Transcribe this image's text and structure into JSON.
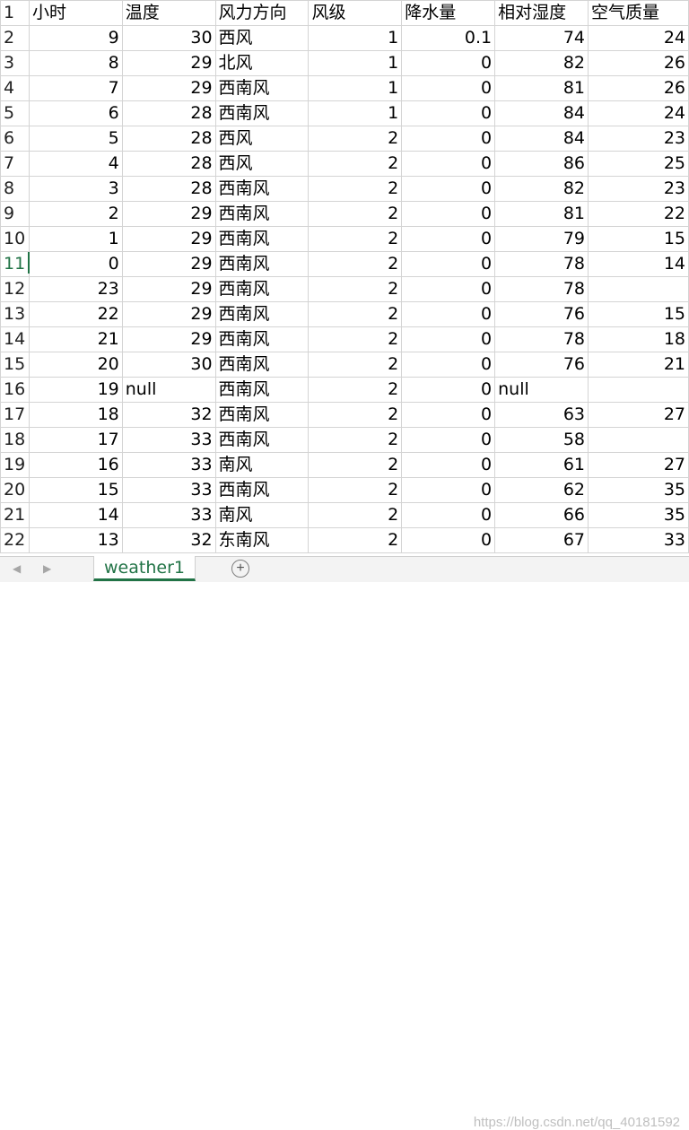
{
  "columns": [
    {
      "label": "小时",
      "align": "num"
    },
    {
      "label": "温度",
      "align": "num"
    },
    {
      "label": "风力方向",
      "align": "txt"
    },
    {
      "label": "风级",
      "align": "num"
    },
    {
      "label": "降水量",
      "align": "num"
    },
    {
      "label": "相对湿度",
      "align": "num"
    },
    {
      "label": "空气质量",
      "align": "num"
    }
  ],
  "header_row_number": "1",
  "selected_row_number": "11",
  "rows": [
    {
      "n": "2",
      "cells": [
        "9",
        "30",
        "西风",
        "1",
        "0.1",
        "74",
        "24"
      ]
    },
    {
      "n": "3",
      "cells": [
        "8",
        "29",
        "北风",
        "1",
        "0",
        "82",
        "26"
      ]
    },
    {
      "n": "4",
      "cells": [
        "7",
        "29",
        "西南风",
        "1",
        "0",
        "81",
        "26"
      ]
    },
    {
      "n": "5",
      "cells": [
        "6",
        "28",
        "西南风",
        "1",
        "0",
        "84",
        "24"
      ]
    },
    {
      "n": "6",
      "cells": [
        "5",
        "28",
        "西风",
        "2",
        "0",
        "84",
        "23"
      ]
    },
    {
      "n": "7",
      "cells": [
        "4",
        "28",
        "西风",
        "2",
        "0",
        "86",
        "25"
      ]
    },
    {
      "n": "8",
      "cells": [
        "3",
        "28",
        "西南风",
        "2",
        "0",
        "82",
        "23"
      ]
    },
    {
      "n": "9",
      "cells": [
        "2",
        "29",
        "西南风",
        "2",
        "0",
        "81",
        "22"
      ]
    },
    {
      "n": "10",
      "cells": [
        "1",
        "29",
        "西南风",
        "2",
        "0",
        "79",
        "15"
      ]
    },
    {
      "n": "11",
      "cells": [
        "0",
        "29",
        "西南风",
        "2",
        "0",
        "78",
        "14"
      ]
    },
    {
      "n": "12",
      "cells": [
        "23",
        "29",
        "西南风",
        "2",
        "0",
        "78",
        ""
      ]
    },
    {
      "n": "13",
      "cells": [
        "22",
        "29",
        "西南风",
        "2",
        "0",
        "76",
        "15"
      ]
    },
    {
      "n": "14",
      "cells": [
        "21",
        "29",
        "西南风",
        "2",
        "0",
        "78",
        "18"
      ]
    },
    {
      "n": "15",
      "cells": [
        "20",
        "30",
        "西南风",
        "2",
        "0",
        "76",
        "21"
      ]
    },
    {
      "n": "16",
      "cells": [
        "19",
        "null",
        "西南风",
        "2",
        "0",
        "null",
        ""
      ]
    },
    {
      "n": "17",
      "cells": [
        "18",
        "32",
        "西南风",
        "2",
        "0",
        "63",
        "27"
      ]
    },
    {
      "n": "18",
      "cells": [
        "17",
        "33",
        "西南风",
        "2",
        "0",
        "58",
        ""
      ]
    },
    {
      "n": "19",
      "cells": [
        "16",
        "33",
        "南风",
        "2",
        "0",
        "61",
        "27"
      ]
    },
    {
      "n": "20",
      "cells": [
        "15",
        "33",
        "西南风",
        "2",
        "0",
        "62",
        "35"
      ]
    },
    {
      "n": "21",
      "cells": [
        "14",
        "33",
        "南风",
        "2",
        "0",
        "66",
        "35"
      ]
    },
    {
      "n": "22",
      "cells": [
        "13",
        "32",
        "东南风",
        "2",
        "0",
        "67",
        "33"
      ]
    }
  ],
  "sheet_tab": {
    "label": "weather1"
  },
  "add_sheet_symbol": "+",
  "nav": {
    "prev": "◀",
    "next": "▶"
  },
  "watermark": "https://blog.csdn.net/qq_40181592",
  "colors": {
    "accent": "#217346",
    "grid": "#d4d4d4"
  }
}
